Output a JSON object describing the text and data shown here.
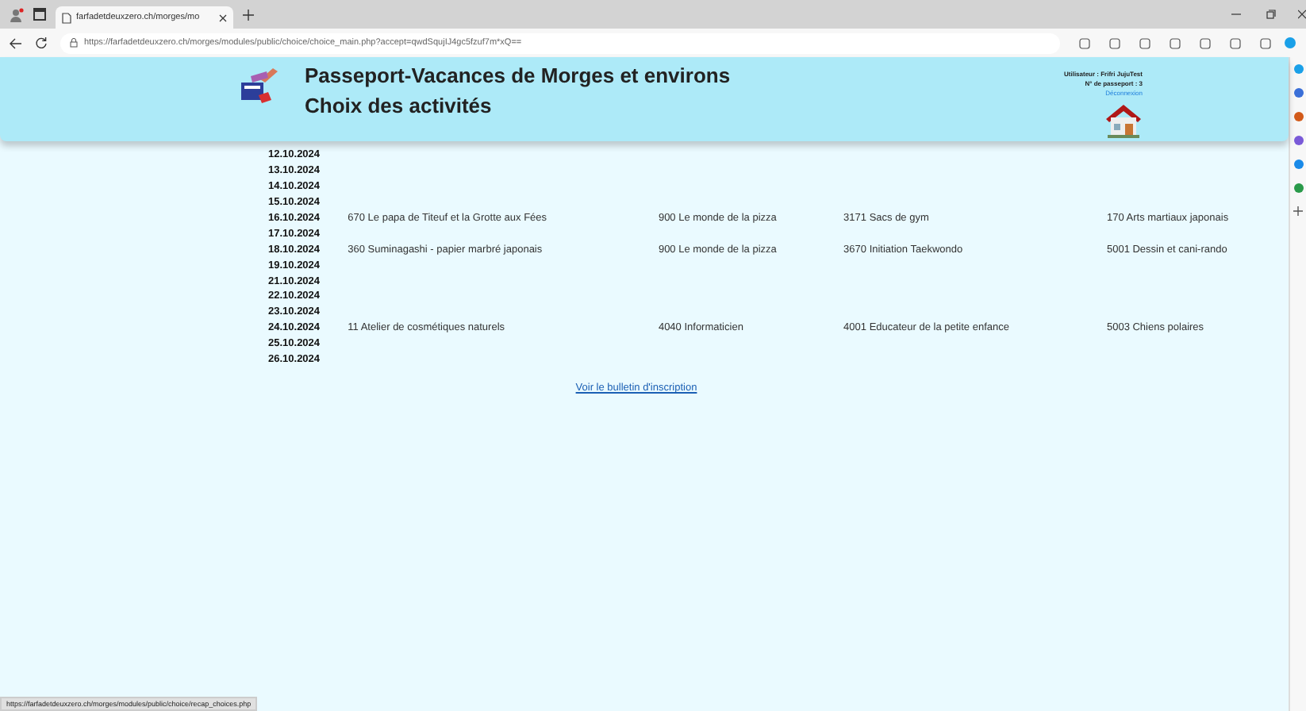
{
  "browser": {
    "tab_title": "farfadetdeuxzero.ch/morges/mo",
    "url": "https://farfadetdeuxzero.ch/morges/modules/public/choice/choice_main.php?accept=qwdSqujIJ4gc5fzuf7m*xQ==",
    "status_url": "https://farfadetdeuxzero.ch/morges/modules/public/choice/recap_choices.php"
  },
  "header": {
    "title": "Passeport-Vacances de Morges et environs",
    "subtitle": "Choix des activités",
    "user": "Utilisateur : Frifri JujuTest",
    "passport": "N° de passeport : 3",
    "logout": "Déconnexion"
  },
  "schedule": [
    {
      "date": "12.10.2024"
    },
    {
      "date": "13.10.2024"
    },
    {
      "date": "14.10.2024"
    },
    {
      "date": "15.10.2024"
    },
    {
      "date": "16.10.2024",
      "activities": [
        "670 Le papa de Titeuf et la Grotte aux Fées",
        "900 Le monde de la pizza",
        "3171 Sacs de gym",
        "170 Arts martiaux japonais"
      ]
    },
    {
      "date": "17.10.2024"
    },
    {
      "date": "18.10.2024",
      "activities": [
        "360 Suminagashi - papier marbré japonais",
        "900 Le monde de la pizza",
        "3670 Initiation Taekwondo",
        "5001 Dessin et cani-rando"
      ]
    },
    {
      "date": "19.10.2024"
    },
    {
      "date": "21.10.2024"
    },
    {
      "date": "22.10.2024"
    },
    {
      "date": "23.10.2024"
    },
    {
      "date": "24.10.2024",
      "activities": [
        "11 Atelier de cosmétiques naturels",
        "4040 Informaticien",
        "4001 Educateur de la petite enfance",
        "5003 Chiens polaires"
      ]
    },
    {
      "date": "25.10.2024"
    },
    {
      "date": "26.10.2024"
    }
  ],
  "link": "Voir le bulletin d'inscription"
}
